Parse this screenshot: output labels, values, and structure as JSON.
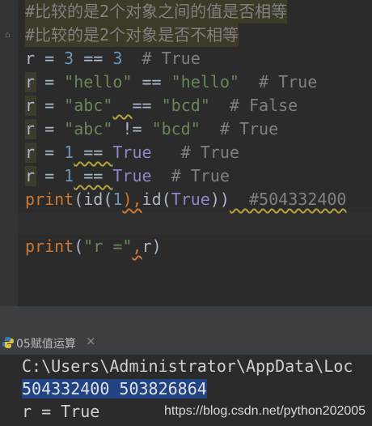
{
  "editor": {
    "lines": [
      {
        "parts": [
          {
            "t": "#比较的是2个对象之间的值是否相等",
            "c": "cm"
          }
        ]
      },
      {
        "parts": [
          {
            "t": "#比较的是2个对象是否不相等",
            "c": "cm"
          }
        ]
      },
      {
        "parts": [
          {
            "t": "r = ",
            "c": "fn"
          },
          {
            "t": "3",
            "c": "num"
          },
          {
            "t": " == ",
            "c": "fn"
          },
          {
            "t": "3",
            "c": "num"
          },
          {
            "t": "  # True",
            "c": "cm"
          }
        ]
      },
      {
        "parts": [
          {
            "t": "r = ",
            "c": "fn"
          },
          {
            "t": "\"hello\"",
            "c": "str"
          },
          {
            "t": " == ",
            "c": "fn"
          },
          {
            "t": "\"hello\"",
            "c": "str"
          },
          {
            "t": "  # True",
            "c": "cm"
          }
        ]
      },
      {
        "parts": [
          {
            "t": "r = ",
            "c": "fn"
          },
          {
            "t": "\"abc\"",
            "c": "str"
          },
          {
            "t": "  ",
            "c": "fn"
          },
          {
            "t": "== ",
            "c": "fn"
          },
          {
            "t": "\"bcd\"",
            "c": "str"
          },
          {
            "t": "  # False",
            "c": "cm"
          }
        ]
      },
      {
        "parts": [
          {
            "t": "r = ",
            "c": "fn"
          },
          {
            "t": "\"abc\"",
            "c": "str"
          },
          {
            "t": " != ",
            "c": "fn"
          },
          {
            "t": "\"bcd\"",
            "c": "str"
          },
          {
            "t": "  # True",
            "c": "cm"
          }
        ]
      },
      {
        "parts": [
          {
            "t": "r = ",
            "c": "fn"
          },
          {
            "t": "1",
            "c": "num"
          },
          {
            "t": " == ",
            "c": "fn"
          },
          {
            "t": "True",
            "c": "bi"
          },
          {
            "t": "   # True",
            "c": "cm"
          }
        ]
      },
      {
        "parts": [
          {
            "t": "r = ",
            "c": "fn"
          },
          {
            "t": "1",
            "c": "num"
          },
          {
            "t": " == ",
            "c": "fn"
          },
          {
            "t": "True",
            "c": "bi"
          },
          {
            "t": "  # True",
            "c": "cm"
          }
        ]
      },
      {
        "parts": [
          {
            "t": "print",
            "c": "kw"
          },
          {
            "t": "(",
            "c": "fn"
          },
          {
            "t": "id",
            "c": "fn"
          },
          {
            "t": "(",
            "c": "fn"
          },
          {
            "t": "1",
            "c": "num"
          },
          {
            "t": "),",
            "c": "fn"
          },
          {
            "t": "id",
            "c": "fn"
          },
          {
            "t": "(",
            "c": "fn"
          },
          {
            "t": "True",
            "c": "bi"
          },
          {
            "t": "))",
            "c": "fn"
          },
          {
            "t": "  #504332400",
            "c": "cm"
          }
        ]
      },
      {
        "parts": [
          {
            "t": "",
            "c": "fn"
          }
        ]
      },
      {
        "parts": [
          {
            "t": "print",
            "c": "kw"
          },
          {
            "t": "(",
            "c": "fn"
          },
          {
            "t": "\"r =\"",
            "c": "str"
          },
          {
            "t": ",",
            "c": "fn"
          },
          {
            "t": "r",
            "c": "fn"
          },
          {
            "t": ")",
            "c": "fn"
          }
        ]
      }
    ]
  },
  "run_panel": {
    "tab_label": "05赋值运算",
    "close_glyph": "×",
    "console_lines": [
      "C:\\Users\\Administrator\\AppData\\Loc",
      "504332400 503826864",
      "r = True"
    ]
  },
  "watermark": "https://blog.csdn.net/python202005",
  "colors": {
    "background": "#2b2b2b",
    "keyword": "#cc7832",
    "string": "#6a8759",
    "number": "#6897bb",
    "builtin": "#8888c6",
    "comment": "#808080",
    "selection": "#214283"
  }
}
